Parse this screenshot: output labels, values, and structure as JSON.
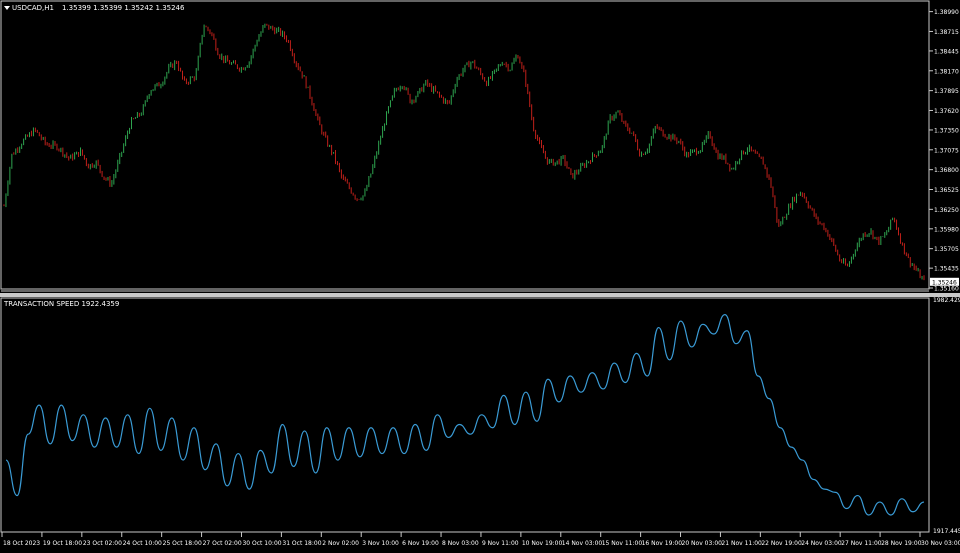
{
  "window": {
    "symbol_label": "USDCAD,H1",
    "ohlc": "1.35399 1.35399 1.35242 1.35246",
    "menu_icon": "triangle-down-icon"
  },
  "indicator": {
    "label": "TRANSACTION SPEED 1922.4359"
  },
  "colors": {
    "background": "#000000",
    "axis": "#c8c8c8",
    "text": "#ffffff",
    "bull": "#2ea44f",
    "bear": "#c0201a",
    "indicator_line": "#3a9bd5",
    "current_price_box": "#ffffff"
  },
  "chart_data": [
    {
      "type": "candlestick",
      "title": "USDCAD,H1",
      "ylim": [
        1.3516,
        1.3904
      ],
      "y_ticks": [
        "1.38990",
        "1.38715",
        "1.38445",
        "1.38170",
        "1.37895",
        "1.37620",
        "1.37350",
        "1.37075",
        "1.36800",
        "1.36525",
        "1.36250",
        "1.35980",
        "1.35705",
        "1.35435",
        "1.35160"
      ],
      "current_price": "1.35246",
      "x_ticks": [
        "18 Oct 2023",
        "19 Oct 18:00",
        "23 Oct 02:00",
        "24 Oct 10:00",
        "25 Oct 18:00",
        "27 Oct 02:00",
        "30 Oct 10:00",
        "31 Oct 18:00",
        "2 Nov 02:00",
        "3 Nov 10:00",
        "6 Nov 19:00",
        "8 Nov 03:00",
        "9 Nov 11:00",
        "10 Nov 19:00",
        "14 Nov 03:00",
        "15 Nov 11:00",
        "16 Nov 19:00",
        "20 Nov 03:00",
        "21 Nov 11:00",
        "22 Nov 19:00",
        "24 Nov 03:00",
        "27 Nov 11:00",
        "28 Nov 19:00",
        "30 Nov 03:00"
      ],
      "price_path": [
        [
          0,
          1.363
        ],
        [
          2,
          1.37
        ],
        [
          5,
          1.372
        ],
        [
          8,
          1.3735
        ],
        [
          11,
          1.3715
        ],
        [
          14,
          1.3712
        ],
        [
          17,
          1.3695
        ],
        [
          20,
          1.3705
        ],
        [
          22,
          1.3685
        ],
        [
          24,
          1.369
        ],
        [
          26,
          1.367
        ],
        [
          28,
          1.366
        ],
        [
          31,
          1.371
        ],
        [
          33,
          1.3745
        ],
        [
          36,
          1.376
        ],
        [
          38,
          1.379
        ],
        [
          41,
          1.38
        ],
        [
          43,
          1.382
        ],
        [
          45,
          1.383
        ],
        [
          47,
          1.38
        ],
        [
          50,
          1.381
        ],
        [
          52,
          1.388
        ],
        [
          54,
          1.387
        ],
        [
          56,
          1.384
        ],
        [
          58,
          1.383
        ],
        [
          60,
          1.3825
        ],
        [
          62,
          1.382
        ],
        [
          64,
          1.383
        ],
        [
          66,
          1.386
        ],
        [
          68,
          1.388
        ],
        [
          70,
          1.3875
        ],
        [
          72,
          1.387
        ],
        [
          74,
          1.386
        ],
        [
          76,
          1.383
        ],
        [
          78,
          1.381
        ],
        [
          80,
          1.378
        ],
        [
          82,
          1.3745
        ],
        [
          84,
          1.372
        ],
        [
          86,
          1.37
        ],
        [
          88,
          1.367
        ],
        [
          90,
          1.3655
        ],
        [
          92,
          1.364
        ],
        [
          94,
          1.3645
        ],
        [
          96,
          1.368
        ],
        [
          98,
          1.372
        ],
        [
          100,
          1.376
        ],
        [
          102,
          1.379
        ],
        [
          104,
          1.38
        ],
        [
          106,
          1.3775
        ],
        [
          108,
          1.3785
        ],
        [
          110,
          1.38
        ],
        [
          112,
          1.379
        ],
        [
          114,
          1.378
        ],
        [
          116,
          1.377
        ],
        [
          118,
          1.3805
        ],
        [
          120,
          1.382
        ],
        [
          122,
          1.383
        ],
        [
          124,
          1.3815
        ],
        [
          126,
          1.38
        ],
        [
          128,
          1.3815
        ],
        [
          130,
          1.383
        ],
        [
          132,
          1.382
        ],
        [
          134,
          1.384
        ],
        [
          136,
          1.3805
        ],
        [
          138,
          1.374
        ],
        [
          140,
          1.371
        ],
        [
          142,
          1.369
        ],
        [
          144,
          1.369
        ],
        [
          146,
          1.3695
        ],
        [
          148,
          1.367
        ],
        [
          150,
          1.368
        ],
        [
          152,
          1.369
        ],
        [
          154,
          1.37
        ],
        [
          156,
          1.371
        ],
        [
          158,
          1.375
        ],
        [
          160,
          1.376
        ],
        [
          162,
          1.374
        ],
        [
          164,
          1.373
        ],
        [
          166,
          1.37
        ],
        [
          168,
          1.371
        ],
        [
          170,
          1.374
        ],
        [
          172,
          1.373
        ],
        [
          174,
          1.3725
        ],
        [
          176,
          1.372
        ],
        [
          178,
          1.37
        ],
        [
          180,
          1.3705
        ],
        [
          182,
          1.371
        ],
        [
          184,
          1.373
        ],
        [
          186,
          1.37
        ],
        [
          188,
          1.3695
        ],
        [
          190,
          1.368
        ],
        [
          192,
          1.37
        ],
        [
          194,
          1.371
        ],
        [
          196,
          1.37
        ],
        [
          198,
          1.369
        ],
        [
          200,
          1.366
        ],
        [
          202,
          1.36
        ],
        [
          204,
          1.362
        ],
        [
          206,
          1.364
        ],
        [
          208,
          1.365
        ],
        [
          210,
          1.363
        ],
        [
          212,
          1.361
        ],
        [
          214,
          1.36
        ],
        [
          216,
          1.358
        ],
        [
          218,
          1.3555
        ],
        [
          220,
          1.3545
        ],
        [
          222,
          1.357
        ],
        [
          224,
          1.359
        ],
        [
          226,
          1.3595
        ],
        [
          228,
          1.358
        ],
        [
          230,
          1.359
        ],
        [
          232,
          1.3615
        ],
        [
          234,
          1.358
        ],
        [
          236,
          1.3555
        ],
        [
          238,
          1.354
        ],
        [
          240,
          1.3525
        ]
      ]
    },
    {
      "type": "line",
      "title": "TRANSACTION SPEED 1922.4359",
      "ylim": [
        1917.4454,
        1982.4293
      ],
      "y_ticks": [
        "1982.4293",
        "1917.4454"
      ],
      "series": [
        {
          "values": [
            1936,
            1925,
            1944,
            1953,
            1941,
            1953,
            1942,
            1950,
            1940,
            1949,
            1940,
            1950,
            1938,
            1952,
            1939,
            1949,
            1936,
            1946,
            1933,
            1941,
            1928,
            1938,
            1927,
            1939,
            1932,
            1947,
            1934,
            1945,
            1932,
            1946,
            1936,
            1946,
            1937,
            1946,
            1938,
            1946,
            1938,
            1947,
            1939,
            1950,
            1943,
            1947,
            1944,
            1950,
            1946,
            1956,
            1947,
            1957,
            1948,
            1961,
            1954,
            1962,
            1957,
            1963,
            1958,
            1966,
            1960,
            1969,
            1962,
            1977,
            1967,
            1979,
            1971,
            1978,
            1975,
            1981,
            1972,
            1976,
            1962,
            1955,
            1946,
            1940,
            1936,
            1930,
            1927,
            1926,
            1921,
            1925,
            1919,
            1923,
            1919,
            1924,
            1920,
            1923
          ]
        }
      ]
    }
  ]
}
